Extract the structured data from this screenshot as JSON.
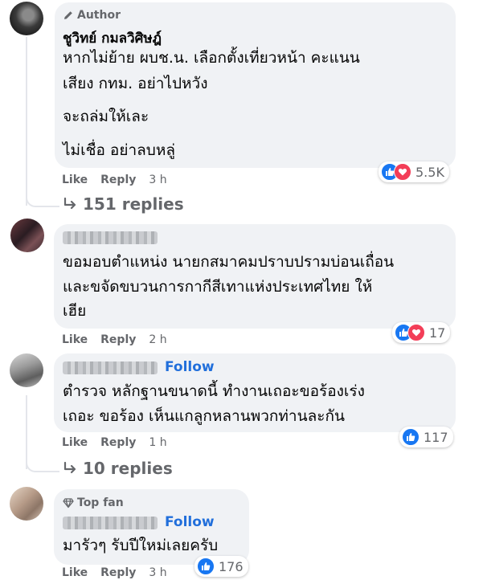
{
  "comments": [
    {
      "badge": "Author",
      "name": "ชูวิทย์ กมลวิศิษฎ์",
      "lines": [
        "หากไม่ย้าย ผบช.น. เลือกตั้งเที่ยวหน้า คะแนน",
        "เสียง กทม. อย่าไปหวัง",
        "จะถล่มให้เละ",
        "ไม่เชื่อ อย่าลบหลู่"
      ],
      "like": "Like",
      "reply": "Reply",
      "time": "3 h",
      "reaction_count": "5.5K",
      "replies": "151 replies"
    },
    {
      "lines": [
        "ขอมอบตำแหน่ง นายกสมาคมปราบปรามบ่อนเถื่อน",
        "และขจัดขบวนการกากีสีเทาแห่งประเทศไทย ให้",
        "เฮีย"
      ],
      "like": "Like",
      "reply": "Reply",
      "time": "2 h",
      "reaction_count": "17"
    },
    {
      "follow": "Follow",
      "lines": [
        "ตำรวจ หลักฐานขนาดนี้ ทำงานเถอะขอร้องเร่ง",
        "เถอะ ขอร้อง เห็นแกลูกหลานพวกท่านละกัน"
      ],
      "like": "Like",
      "reply": "Reply",
      "time": "1 h",
      "reaction_count": "117",
      "replies": "10 replies"
    },
    {
      "badge": "Top fan",
      "follow": "Follow",
      "lines": [
        "มารัวๆ รับปีใหม่เลยครับ"
      ],
      "like": "Like",
      "reply": "Reply",
      "time": "3 h",
      "reaction_count": "176"
    }
  ],
  "colors": {
    "like_blue": "#1877f2",
    "love_red": "#f33e58",
    "link_blue": "#216fdb",
    "bubble": "#f0f2f5",
    "meta_gray": "#65676b"
  }
}
